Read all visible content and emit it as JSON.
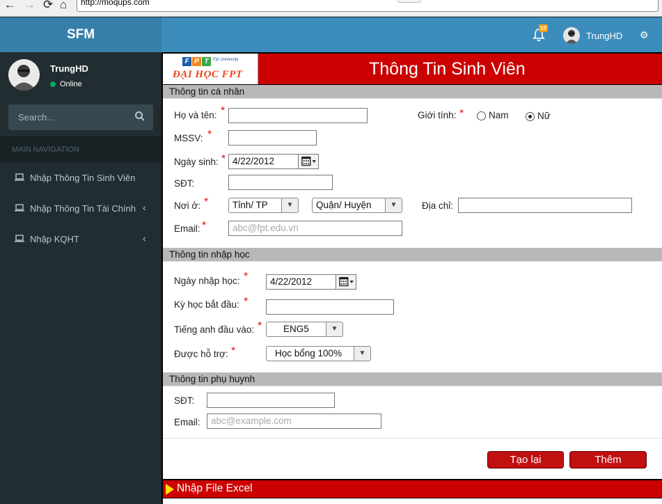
{
  "browser": {
    "url": "http://moqups.com",
    "url_button": "···"
  },
  "header": {
    "app_title": "SFM",
    "notification_count": "10",
    "user_name": "TrungHD"
  },
  "sidebar": {
    "user_name": "TrungHD",
    "status": "Online",
    "search_placeholder": "Search...",
    "menu_header": "MAIN NAVIGATION",
    "items": [
      {
        "label": "Nhập Thông Tin Sinh Viên",
        "icon": "laptop-icon",
        "has_chevron": false
      },
      {
        "label": "Nhập Thông Tin Tài Chính",
        "icon": "laptop-icon",
        "has_chevron": true
      },
      {
        "label": "Nhập KQHT",
        "icon": "laptop-icon",
        "has_chevron": true
      }
    ]
  },
  "banner": {
    "logo_text": "ĐẠI HỌC FPT",
    "logo_letters": [
      "F",
      "P",
      "T"
    ],
    "logo_sub": "Fpt University",
    "title": "Thông Tin Sinh Viên"
  },
  "personal": {
    "section_title": "Thông tin cá nhân",
    "fullname_label": "Họ và tên:",
    "fullname_value": "",
    "gender_label": "Giới tính:",
    "gender_options": [
      "Nam",
      "Nữ"
    ],
    "gender_selected": "Nữ",
    "mssv_label": "MSSV:",
    "mssv_value": "",
    "dob_label": "Ngày sinh:",
    "dob_value": "4/22/2012",
    "phone_label": "SĐT:",
    "phone_value": "",
    "residence_label": "Nơi ở:",
    "province_value": "Tỉnh/ TP",
    "district_value": "Quận/ Huyện",
    "address_label": "Địa chỉ:",
    "address_value": "",
    "email_label": "Email:",
    "email_placeholder": "abc@fpt.edu.vn",
    "required_mark": "*"
  },
  "enrollment": {
    "section_title": "Thông tin nhập học",
    "enroll_date_label": "Ngày nhập học:",
    "enroll_date_value": "4/22/2012",
    "start_term_label": "Kỳ học bắt đầu:",
    "start_term_value": "",
    "english_label": "Tiếng anh đầu vào:",
    "english_value": "ENG5",
    "support_label": "Được hỗ trợ:",
    "support_value": "Học bổng 100%"
  },
  "parent": {
    "section_title": "Thông tin phụ huynh",
    "phone_label": "SĐT:",
    "phone_value": "",
    "email_label": "Email:",
    "email_placeholder": "abc@example.com"
  },
  "actions": {
    "reset_label": "Tạo lại",
    "add_label": "Thêm"
  },
  "excel": {
    "label": "Nhập File Excel"
  },
  "colors": {
    "primary_blue": "#3c8dbc",
    "logo_blue": "#367fa9",
    "sidebar_dark": "#222d32",
    "banner_red": "#cc0000",
    "section_gray": "#b8b8b8"
  }
}
